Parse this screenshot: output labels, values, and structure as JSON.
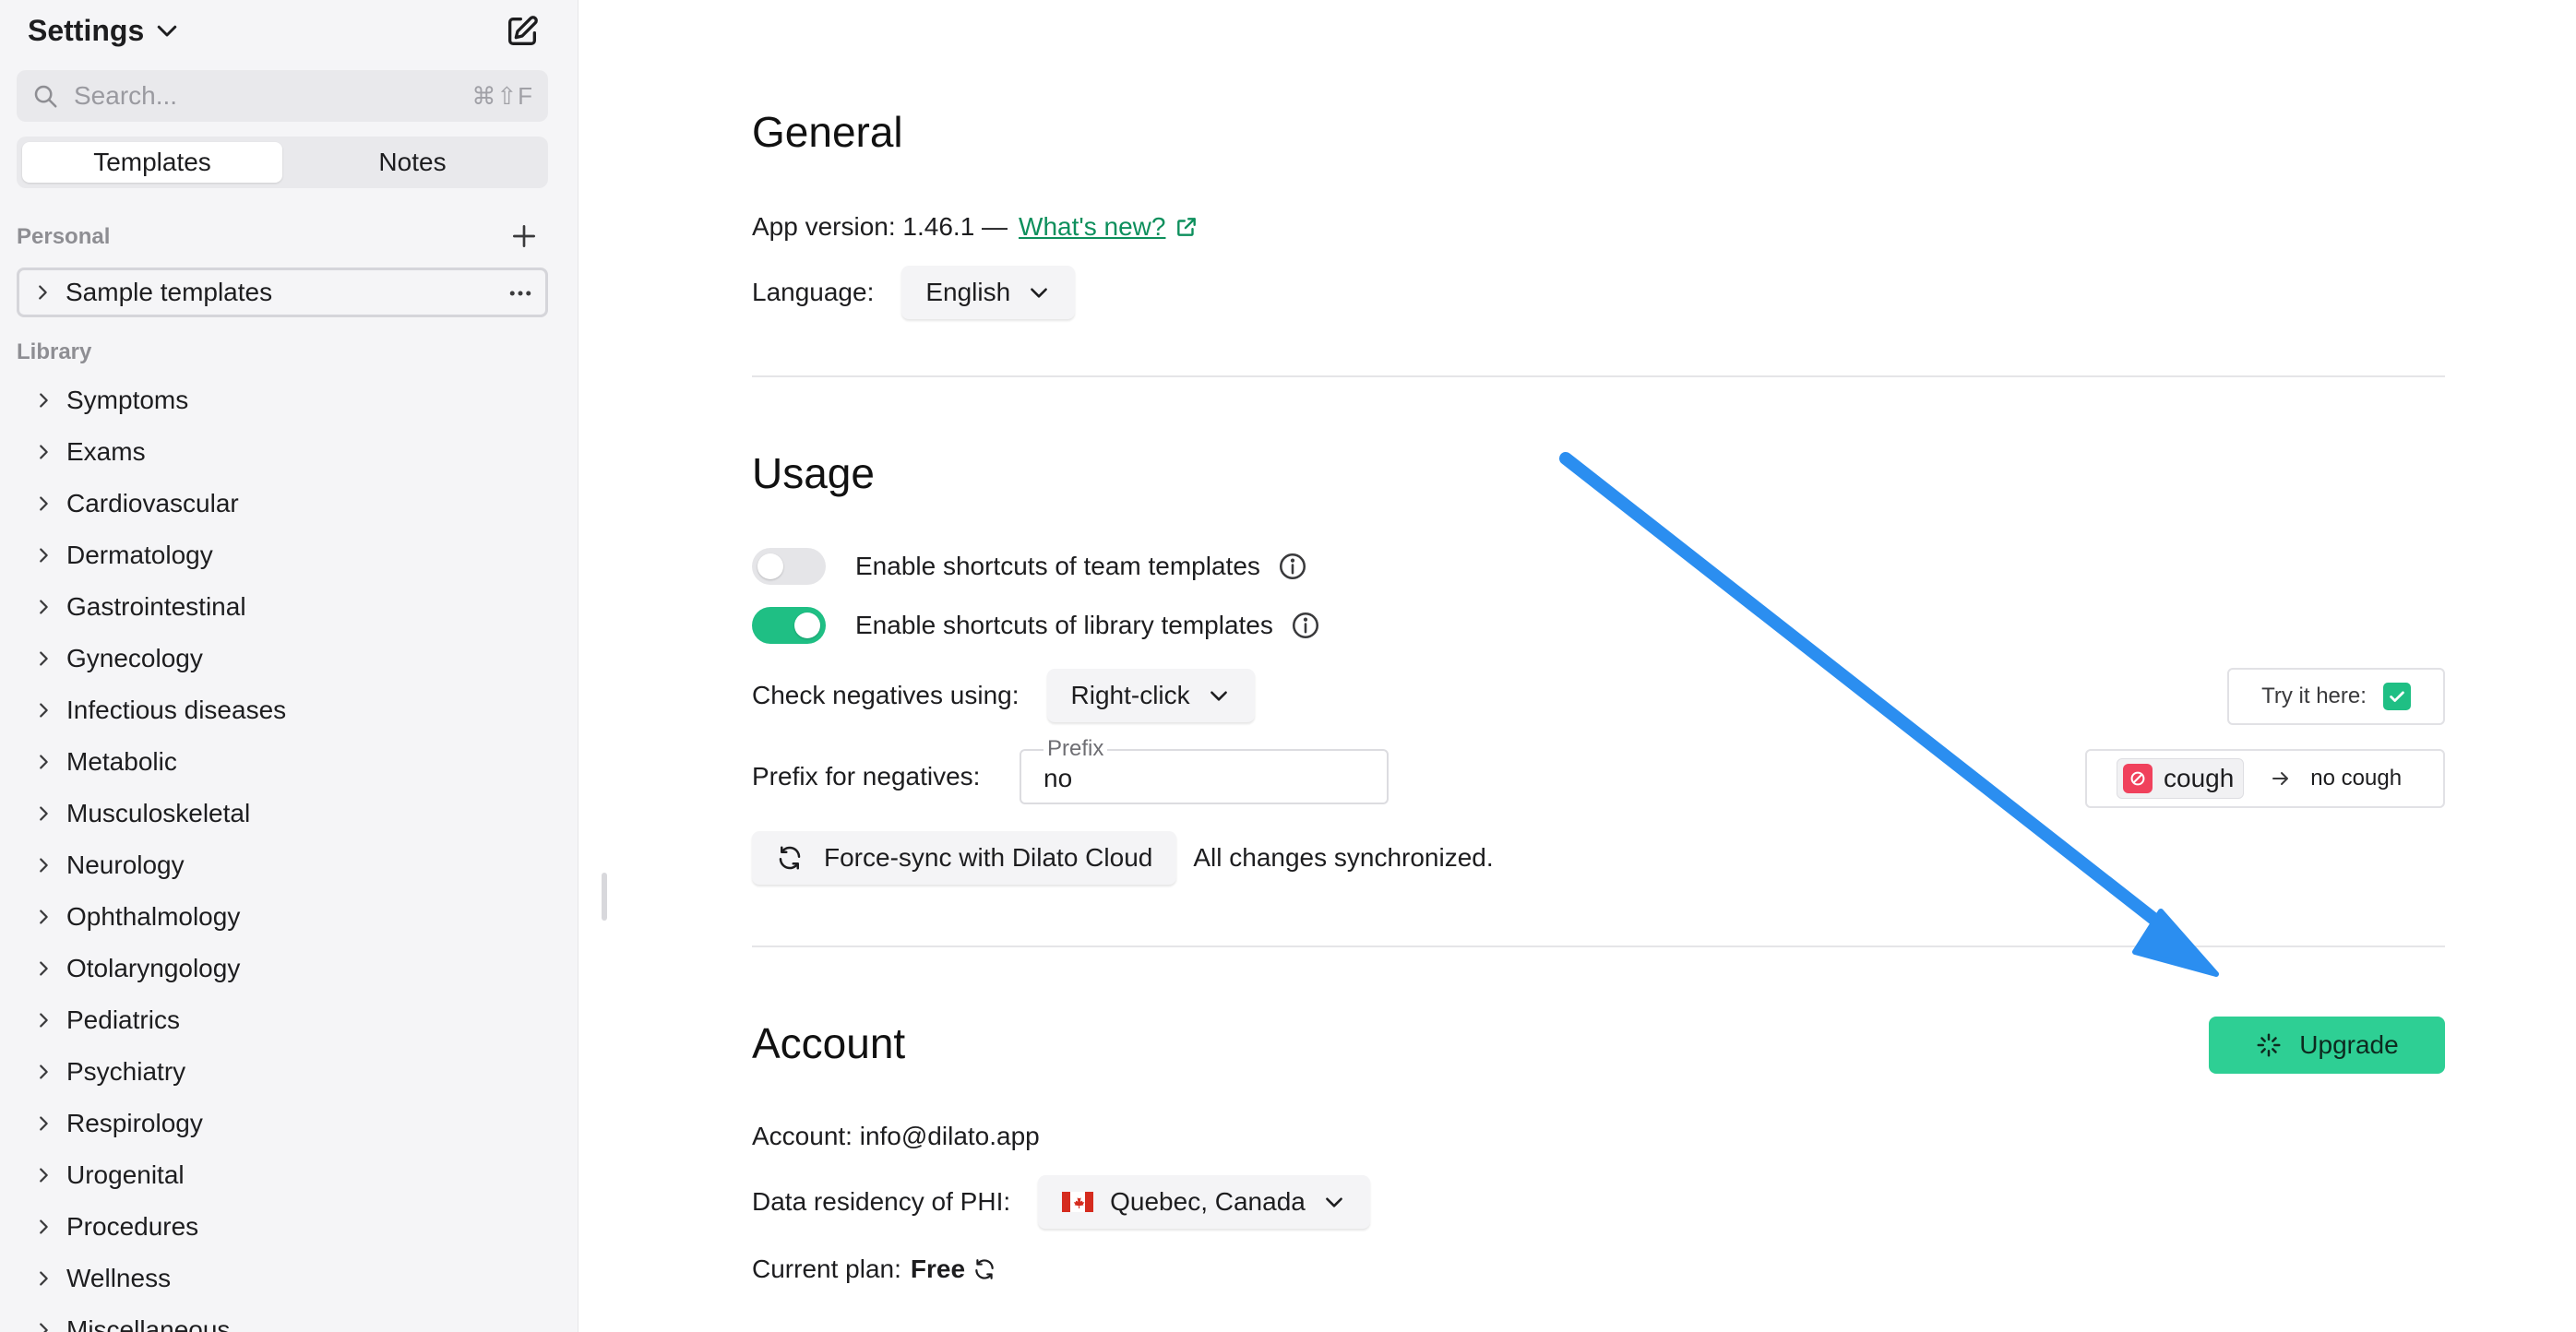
{
  "sidebar": {
    "title": "Settings",
    "search": {
      "placeholder": "Search...",
      "shortcut": "⌘⇧F"
    },
    "tabs": [
      {
        "label": "Templates",
        "active": true
      },
      {
        "label": "Notes",
        "active": false
      }
    ],
    "personal": {
      "label": "Personal",
      "items": [
        {
          "label": "Sample templates"
        }
      ]
    },
    "library": {
      "label": "Library",
      "items": [
        {
          "label": "Symptoms"
        },
        {
          "label": "Exams"
        },
        {
          "label": "Cardiovascular"
        },
        {
          "label": "Dermatology"
        },
        {
          "label": "Gastrointestinal"
        },
        {
          "label": "Gynecology"
        },
        {
          "label": "Infectious diseases"
        },
        {
          "label": "Metabolic"
        },
        {
          "label": "Musculoskeletal"
        },
        {
          "label": "Neurology"
        },
        {
          "label": "Ophthalmology"
        },
        {
          "label": "Otolaryngology"
        },
        {
          "label": "Pediatrics"
        },
        {
          "label": "Psychiatry"
        },
        {
          "label": "Respirology"
        },
        {
          "label": "Urogenital"
        },
        {
          "label": "Procedures"
        },
        {
          "label": "Wellness"
        },
        {
          "label": "Miscellaneous"
        }
      ]
    }
  },
  "general": {
    "heading": "General",
    "app_version_label": "App version: 1.46.1 —",
    "whats_new": "What's new?",
    "language_label": "Language:",
    "language_value": "English"
  },
  "usage": {
    "heading": "Usage",
    "team_shortcuts": {
      "label": "Enable shortcuts of team templates",
      "enabled": false
    },
    "library_shortcuts": {
      "label": "Enable shortcuts of library templates",
      "enabled": true
    },
    "check_negatives_label": "Check negatives using:",
    "check_negatives_value": "Right-click",
    "try_it_label": "Try it here:",
    "prefix_label": "Prefix for negatives:",
    "prefix_legend": "Prefix",
    "prefix_value": "no",
    "demo_word": "cough",
    "demo_result": "no cough",
    "sync_button": "Force-sync with Dilato Cloud",
    "sync_status": "All changes synchronized."
  },
  "account": {
    "heading": "Account",
    "upgrade_button": "Upgrade",
    "account_label": "Account: info@dilato.app",
    "residency_label": "Data residency of PHI:",
    "residency_value": "Quebec, Canada",
    "plan_label": "Current plan:",
    "plan_value": "Free"
  },
  "colors": {
    "accent_green": "#1fbf84",
    "upgrade_green": "#2ecf94",
    "link_green": "#0d8f5c",
    "negative_red": "#f0415c",
    "annotation_arrow_blue": "#2b8ef0"
  },
  "icons": {
    "title_chevron": "chevron-down-icon",
    "compose": "edit-icon",
    "search": "search-icon",
    "add": "plus-icon",
    "more": "more-icon",
    "external": "external-link-icon",
    "info": "info-icon",
    "sync": "sync-icon",
    "upgrade": "sparkle-icon",
    "flag": "canada-flag-icon"
  }
}
